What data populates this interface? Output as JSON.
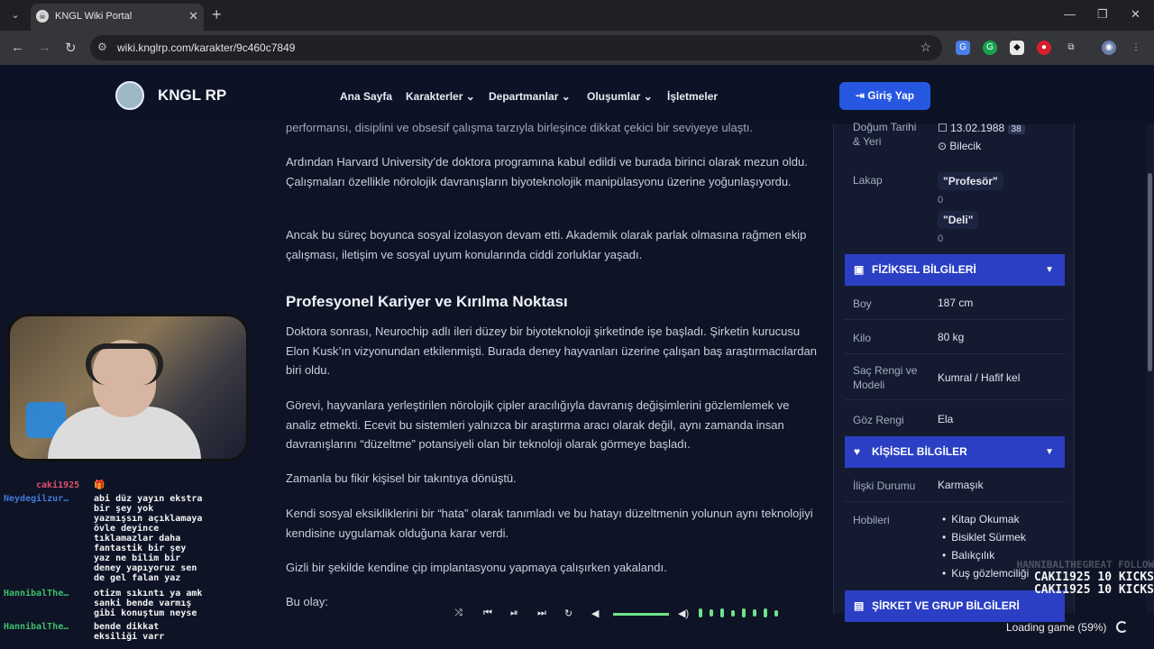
{
  "browser": {
    "tab_title": "KNGL Wiki Portal",
    "url": "wiki.knglrp.com/karakter/9c460c7849"
  },
  "site": {
    "logo_text": "KNGL RP",
    "nav": [
      "Ana Sayfa",
      "Karakterler",
      "Departmanlar",
      "Oluşumlar",
      "İşletmeler"
    ],
    "login_label": "Giriş Yap"
  },
  "article": {
    "p0": "performansı, disiplini ve obsesif çalışma tarzıyla birleşince dikkat çekici bir seviyeye ulaştı.",
    "p1": "Ardından Harvard University’de doktora programına kabul edildi ve burada birinci olarak mezun oldu. Çalışmaları özellikle nörolojik davranışların biyoteknolojik manipülasyonu üzerine yoğunlaşıyordu.",
    "p2": "Ancak bu süreç boyunca sosyal izolasyon devam etti. Akademik olarak parlak olmasına rağmen ekip çalışması, iletişim ve sosyal uyum konularında ciddi zorluklar yaşadı.",
    "heading": "Profesyonel Kariyer ve Kırılma Noktası",
    "p3": "Doktora sonrası, Neurochip adlı ileri düzey bir biyoteknoloji şirketinde işe başladı. Şirketin kurucusu Elon Kusk’ın vizyonundan etkilenmişti. Burada deney hayvanları üzerine çalışan baş araştırmacılardan biri oldu.",
    "p4": "Görevi, hayvanlara yerleştirilen nörolojik çipler aracılığıyla davranış değişimlerini gözlemlemek ve analiz etmekti. Ecevit bu sistemleri yalnızca bir araştırma aracı olarak değil, aynı zamanda insan davranışlarını “düzeltme” potansiyeli olan bir teknoloji olarak görmeye başladı.",
    "p5": "Zamanla bu fikir kişisel bir takıntıya dönüştü.",
    "p6": "Kendi sosyal eksikliklerini bir “hata” olarak tanımladı ve bu hatayı düzeltmenin yolunun aynı teknolojiyi kendisine uygulamak olduğuna karar verdi.",
    "p7": "Gizli bir şekilde kendine çip implantasyonu yapmaya çalışırken yakalandı.",
    "p8": "Bu olay:"
  },
  "sidebar": {
    "birth_label": "Doğum Tarihi & Yeri",
    "birth_date": "13.02.1988",
    "age": "38",
    "birth_place": "Bilecik",
    "nick_label": "Lakap",
    "nicknames": [
      {
        "text": "\"Profesör\"",
        "count": "0"
      },
      {
        "text": "\"Deli\"",
        "count": "0"
      }
    ],
    "physical_header": "FİZİKSEL BİLGİLERİ",
    "height_label": "Boy",
    "height": "187 cm",
    "weight_label": "Kilo",
    "weight": "80 kg",
    "hair_label": "Saç Rengi ve Modeli",
    "hair": "Kumral / Hafif kel",
    "eye_label": "Göz Rengi",
    "eye": "Ela",
    "personal_header": "KİŞİSEL BİLGİLER",
    "relationship_label": "İlişki Durumu",
    "relationship": "Karmaşık",
    "hobbies_label": "Hobileri",
    "hobbies": [
      "Kitap Okumak",
      "Bisiklet Sürmek",
      "Balıkçılık",
      "Kuş gözlemciliği"
    ],
    "company_header": "ŞİRKET VE GRUP BİLGİLERİ"
  },
  "stream": {
    "chat": [
      {
        "name": "caki1925",
        "msg": "🎁",
        "name_color": "#e0506a"
      },
      {
        "name": "Neydegilzur…",
        "msg": "abi düz yayın ekstra\nbir şey yok\nyazmışsın açıklamaya\növle deyince\ntıklamazlar daha\nfantastik bir şey\nyaz ne bilim bir\ndeney yapıyoruz sen\nde gel falan yaz",
        "name_color": "#3f7ad8"
      },
      {
        "name": "HannibalThe…",
        "msg": "otizm sıkıntı ya amk\nsanki bende varmış\ngibi konuştum neyse",
        "name_color": "#3fbf6a"
      },
      {
        "name": "HannibalThe…",
        "msg": "bende dikkat\neksiliği varr",
        "name_color": "#3fbf6a"
      }
    ],
    "alert_faint": "HANNIBALTHEGREAT FOLLOW",
    "alert1": "CAKI1925 10 KICKS",
    "alert2": "CAKI1925 10 KICKS",
    "loading_text": "Loading game (59%)",
    "accent": "#6fe28b"
  }
}
